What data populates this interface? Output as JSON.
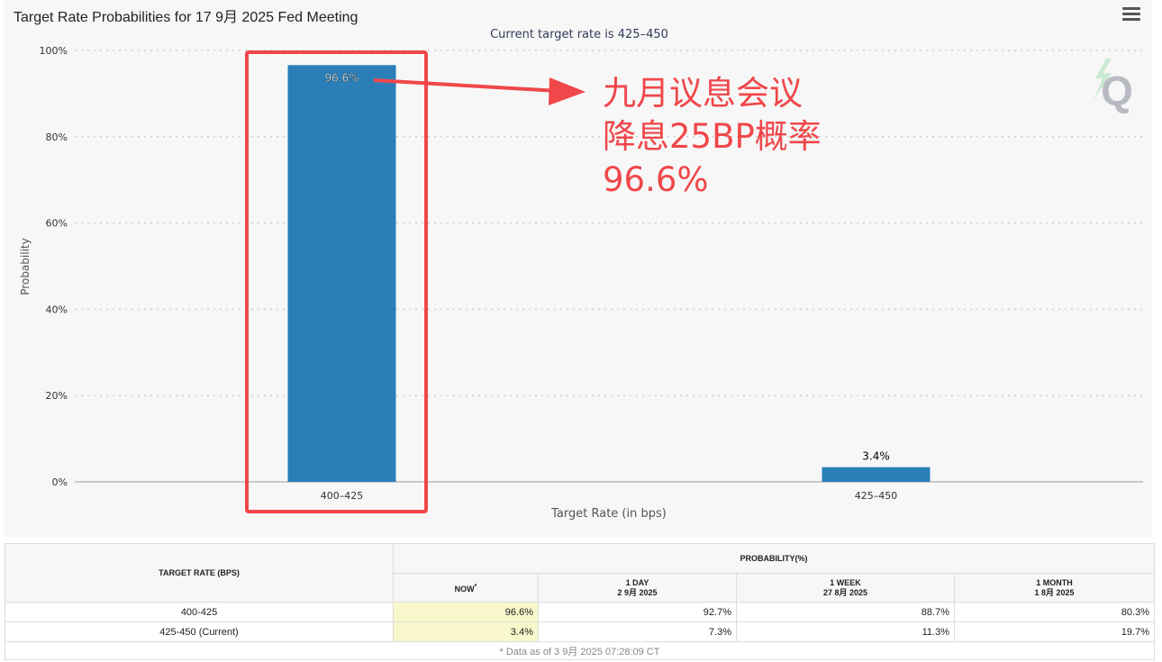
{
  "page_title": "Target Rate Probabilities for 17 9月 2025 Fed Meeting",
  "menu_icon": "hamburger-menu-icon",
  "watermark_icon": "q-logo-icon",
  "chart_data": {
    "type": "bar",
    "subtitle": "Current target rate is 425–450",
    "xlabel": "Target Rate (in bps)",
    "ylabel": "Probability",
    "categories": [
      "400–425",
      "425–450"
    ],
    "values": [
      96.6,
      3.4
    ],
    "data_labels": [
      "96.6%",
      "3.4%"
    ],
    "ylim": [
      0,
      100
    ],
    "yticks": [
      0,
      20,
      40,
      60,
      80,
      100
    ],
    "ytick_labels": [
      "0%",
      "20%",
      "40%",
      "60%",
      "80%",
      "100%"
    ],
    "grid": true,
    "bar_color": "#2a7fb8"
  },
  "annotation": {
    "lines": [
      "九月议息会议",
      "降息25BP概率",
      "96.6%"
    ],
    "color": "#f0474a"
  },
  "table": {
    "header_rate": "TARGET RATE (BPS)",
    "header_prob": "PROBABILITY(%)",
    "col_now": "NOW",
    "col_now_mark": "*",
    "col_1day": "1 DAY",
    "col_1day_date": "2 9月 2025",
    "col_1week": "1 WEEK",
    "col_1week_date": "27 8月 2025",
    "col_1month": "1 MONTH",
    "col_1month_date": "1 8月 2025",
    "rows": [
      {
        "rate": "400-425",
        "now": "96.6%",
        "day": "92.7%",
        "week": "88.7%",
        "month": "80.3%"
      },
      {
        "rate": "425-450 (Current)",
        "now": "3.4%",
        "day": "7.3%",
        "week": "11.3%",
        "month": "19.7%"
      }
    ],
    "footnote": "* Data as of 3 9月 2025 07:28:09 CT"
  }
}
